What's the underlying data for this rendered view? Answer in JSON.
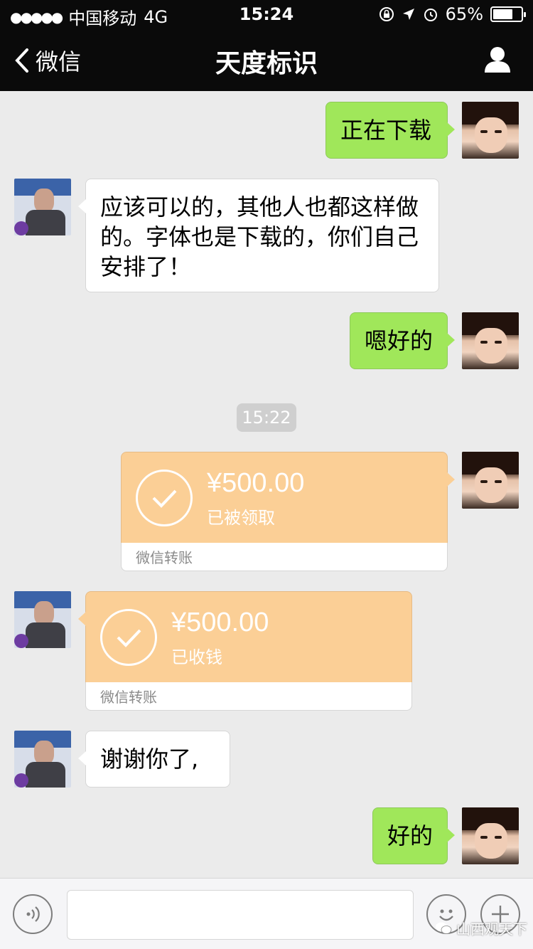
{
  "status_bar": {
    "signal": "●●●●●",
    "carrier": "中国移动",
    "network": "4G",
    "time": "15:24",
    "battery": "65%"
  },
  "nav": {
    "back_label": "微信",
    "title": "天度标识"
  },
  "messages": {
    "m1": "正在下载",
    "m2_lines": [
      "应该可以的，其他人也都这样做",
      "的。字体也是下载的，你们自己",
      "安排了！"
    ],
    "m3": "嗯好的",
    "timestamp": "15:22",
    "transfer_out": {
      "amount": "¥500.00",
      "status": "已被领取",
      "footer": "微信转账"
    },
    "transfer_in": {
      "amount": "¥500.00",
      "status": "已收钱",
      "footer": "微信转账"
    },
    "m4": "谢谢你了,",
    "m5": "好的"
  },
  "watermark": "山西观天下",
  "colors": {
    "outgoing_bubble": "#a0e75a",
    "transfer": "#fbcf96",
    "nav_bg": "#0a0a0a"
  }
}
